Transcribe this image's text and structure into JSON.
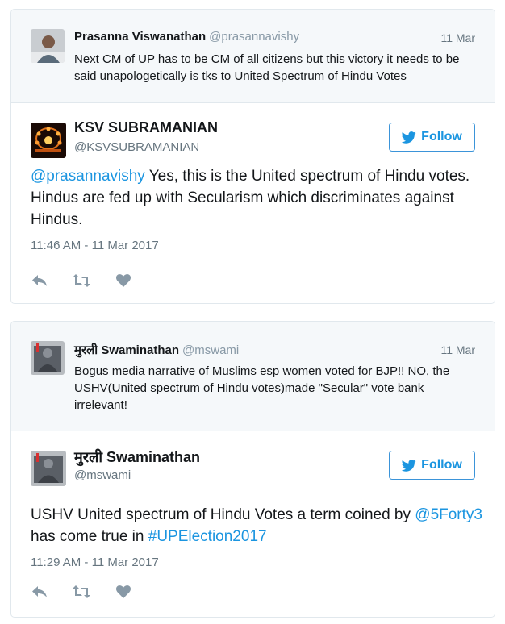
{
  "tweets": [
    {
      "quoted": {
        "name": "Prasanna Viswanathan",
        "handle": "@prasannavishy",
        "date": "11 Mar",
        "text": "Next CM of UP has to be CM of all citizens but this victory it needs to be said unapologetically is tks to United Spectrum of Hindu Votes"
      },
      "author": {
        "name": "KSV SUBRAMANIAN",
        "handle": "@KSVSUBRAMANIAN"
      },
      "follow_label": "Follow",
      "text_parts": {
        "mention": "@prasannavishy",
        "body": " Yes, this is the United spectrum of Hindu votes. Hindus are fed up with Secularism which discriminates against Hindus."
      },
      "timestamp": "11:46 AM - 11 Mar 2017"
    },
    {
      "quoted": {
        "name": "मुरली Swaminathan",
        "handle": "@mswami",
        "date": "11 Mar",
        "text": "Bogus media narrative of Muslims esp women voted for BJP!! NO, the USHV(United spectrum of Hindu votes)made \"Secular\" vote bank irrelevant!"
      },
      "author": {
        "name": "मुरली Swaminathan",
        "handle": "@mswami"
      },
      "follow_label": "Follow",
      "text_parts": {
        "lead": "USHV United spectrum of Hindu Votes a term coined by ",
        "mention": "@5Forty3",
        "middle": " has come true in ",
        "hashtag": "#UPElection2017"
      },
      "timestamp": "11:29 AM - 11 Mar 2017"
    }
  ],
  "colors": {
    "accent": "#1b95e0",
    "muted": "#66757f",
    "quote_bg": "#f5f8fa",
    "border": "#e1e8ed"
  },
  "icons": [
    "bird-icon",
    "reply-icon",
    "retweet-icon",
    "heart-icon"
  ]
}
